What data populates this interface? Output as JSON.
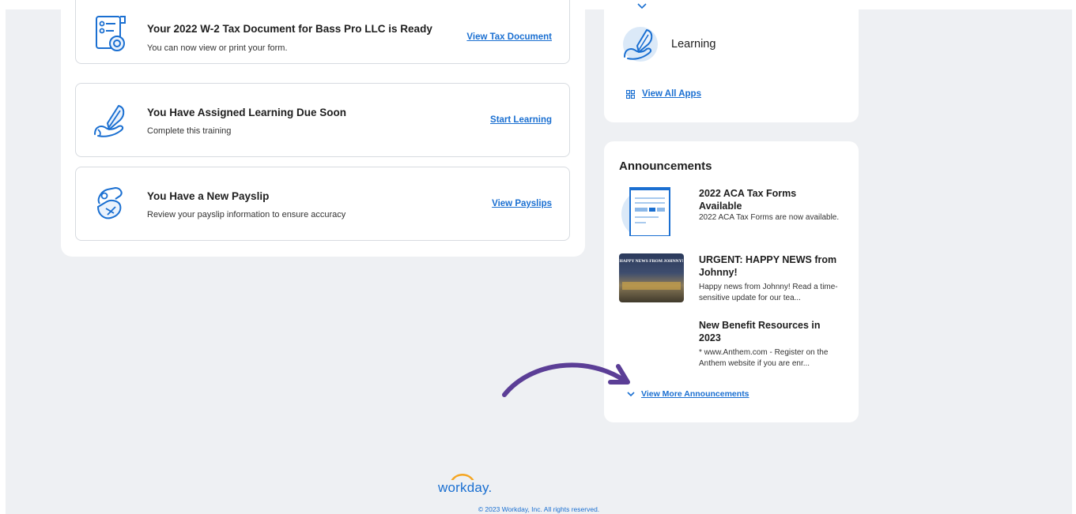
{
  "tasks": [
    {
      "title": "Your 2022 W-2 Tax Document for Bass Pro LLC is Ready",
      "subtitle": "You can now view or print your form.",
      "action": "View Tax Document",
      "icon": "tax-document-icon"
    },
    {
      "title": "You Have Assigned Learning Due Soon",
      "subtitle": "Complete this training",
      "action": "Start Learning",
      "icon": "learning-icon"
    },
    {
      "title": "You Have a New Payslip",
      "subtitle": "Review your payslip information to ensure accuracy",
      "action": "View Payslips",
      "icon": "payslip-icon"
    }
  ],
  "apps": {
    "learning_label": "Learning",
    "view_all": "View All Apps"
  },
  "announcements": {
    "heading": "Announcements",
    "items": [
      {
        "title": "2022 ACA Tax Forms Available",
        "desc": "2022 ACA Tax Forms are now available."
      },
      {
        "title": "URGENT: HAPPY NEWS from Johnny!",
        "desc": "Happy news from Johnny! Read a time-sensitive update for our tea...",
        "thumb_text": "HAPPY NEWS FROM JOHNNY!"
      },
      {
        "title": "New Benefit Resources in 2023",
        "desc": "* www.Anthem.com - Register on the Anthem website if you are enr..."
      }
    ],
    "view_more": "View More Announcements"
  },
  "footer": {
    "logo": "workday.",
    "copyright": "© 2023 Workday, Inc. All rights reserved."
  },
  "colors": {
    "accent": "#1a6fd1",
    "arrow": "#5b3e96",
    "background": "#eef0f3"
  }
}
